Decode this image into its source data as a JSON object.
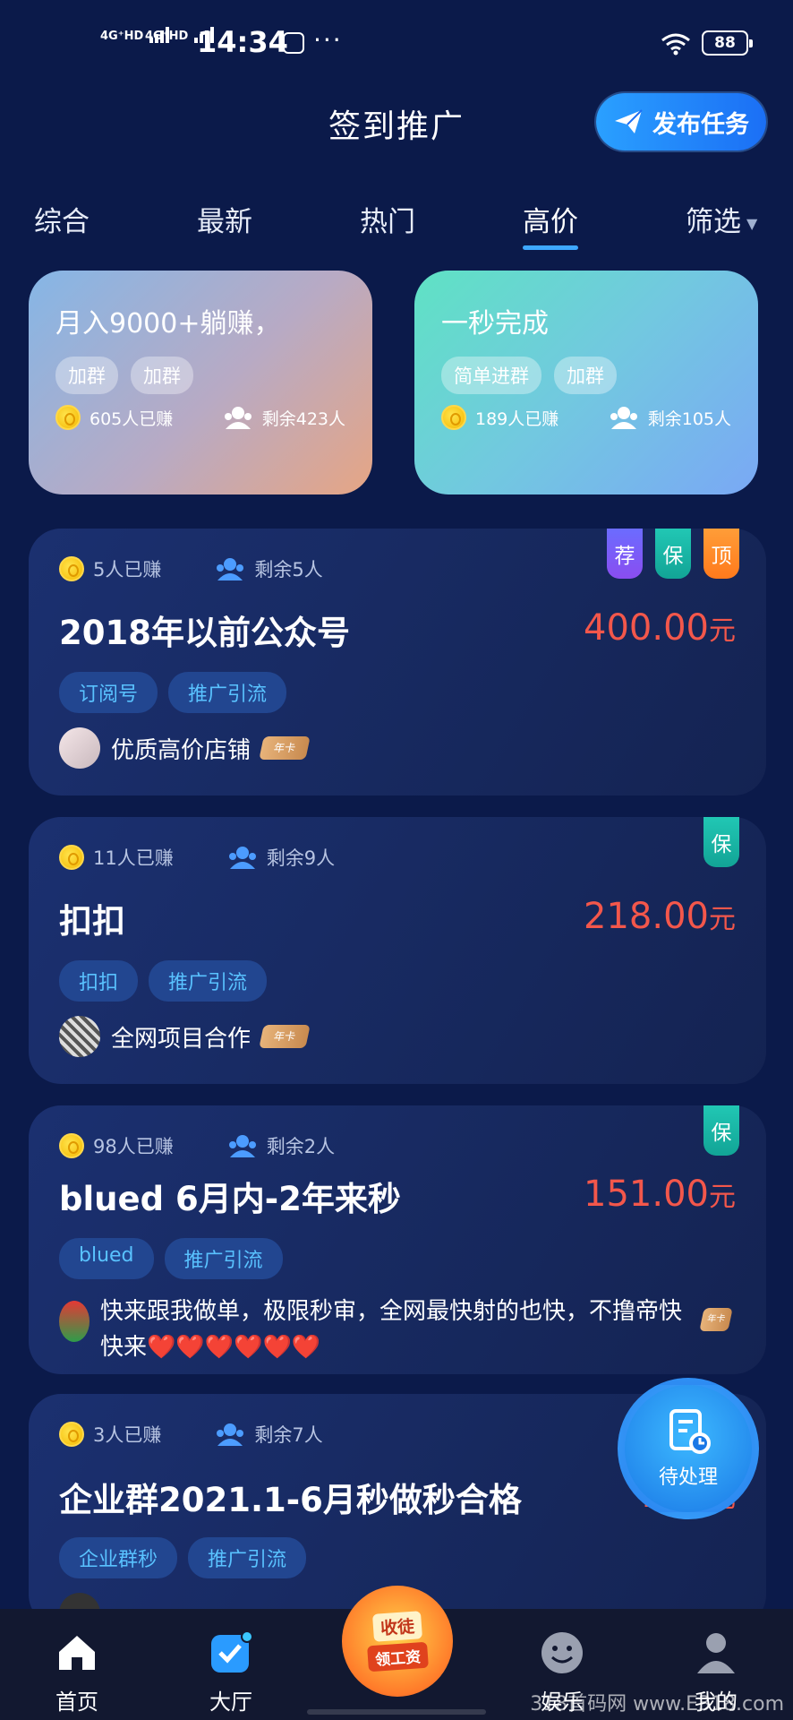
{
  "status_bar": {
    "sim1": "4G⁺HD",
    "sim2": "4G⁺HD",
    "time": "14:34",
    "more": "···",
    "battery": "88"
  },
  "header": {
    "title": "签到推广",
    "publish_label": "发布任务"
  },
  "tabs": [
    {
      "label": "综合"
    },
    {
      "label": "最新"
    },
    {
      "label": "热门"
    },
    {
      "label": "高价",
      "active": true
    },
    {
      "label": "筛选"
    }
  ],
  "featured": [
    {
      "title": "月入9000+躺赚，",
      "tags": [
        "加群",
        "加群"
      ],
      "earned": "605人已赚",
      "remaining": "剩余423人"
    },
    {
      "title": "一秒完成",
      "tags": [
        "简单进群",
        "加群"
      ],
      "earned": "189人已赚",
      "remaining": "剩余105人"
    }
  ],
  "tasks": [
    {
      "earned": "5人已赚",
      "remaining": "剩余5人",
      "title": "2018年以前公众号",
      "price": "400.00",
      "unit": "元",
      "tags": [
        "订阅号",
        "推广引流"
      ],
      "owner": "优质高价店铺",
      "owner_badge": "年卡",
      "badges": [
        "荐",
        "保",
        "顶"
      ]
    },
    {
      "earned": "11人已赚",
      "remaining": "剩余9人",
      "title": "扣扣",
      "price": "218.00",
      "unit": "元",
      "tags": [
        "扣扣",
        "推广引流"
      ],
      "owner": "全网项目合作",
      "owner_badge": "年卡",
      "badges": [
        "保"
      ]
    },
    {
      "earned": "98人已赚",
      "remaining": "剩余2人",
      "title": "blued 6月内-2年来秒",
      "price": "151.00",
      "unit": "元",
      "tags": [
        "blued",
        "推广引流"
      ],
      "owner": "快来跟我做单，极限秒审，全网最快射的也快，不撸帝快快来❤️❤️❤️❤️❤️❤️",
      "owner_badge": "年卡",
      "badges": [
        "保"
      ]
    },
    {
      "earned": "3人已赚",
      "remaining": "剩余7人",
      "title": "企业群2021.1-6月秒做秒合格",
      "price": "150",
      "unit": "元",
      "tags": [
        "企业群秒",
        "推广引流"
      ],
      "owner": "",
      "owner_badge": "",
      "badges": []
    }
  ],
  "fab": {
    "label": "待处理"
  },
  "bottom_nav": {
    "items": [
      {
        "label": "首页"
      },
      {
        "label": "大厅"
      },
      {
        "label": "娱乐"
      },
      {
        "label": "我的"
      }
    ],
    "center_line1": "收徒",
    "center_line2": "领工资"
  },
  "watermark": "318首码网 www.E318.com"
}
